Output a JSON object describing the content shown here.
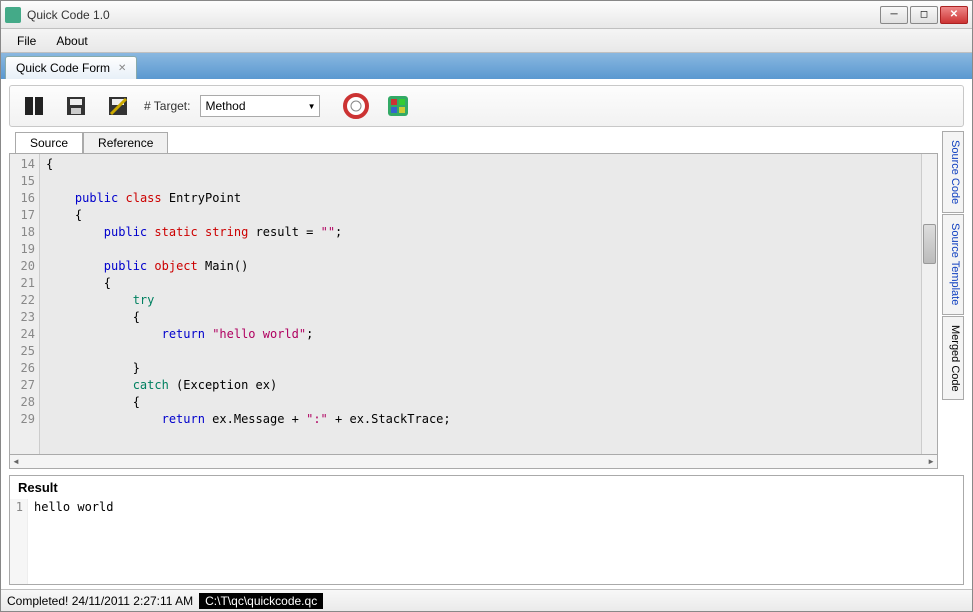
{
  "window": {
    "title": "Quick Code 1.0"
  },
  "menu": {
    "file": "File",
    "about": "About"
  },
  "docTab": {
    "label": "Quick Code Form"
  },
  "toolbar": {
    "targetLabel": "# Target:",
    "targetValue": "Method"
  },
  "codeTabs": {
    "source": "Source",
    "reference": "Reference"
  },
  "sideTabs": {
    "sourceCode": "Source Code",
    "sourceTemplate": "Source Template",
    "mergedCode": "Merged Code"
  },
  "code": {
    "startLine": 14,
    "lines": [
      [
        {
          "t": "{",
          "c": ""
        }
      ],
      [],
      [
        {
          "t": "    ",
          "c": ""
        },
        {
          "t": "public",
          "c": "kw-blue"
        },
        {
          "t": " ",
          "c": ""
        },
        {
          "t": "class",
          "c": "kw-red"
        },
        {
          "t": " EntryPoint",
          "c": ""
        }
      ],
      [
        {
          "t": "    {",
          "c": ""
        }
      ],
      [
        {
          "t": "        ",
          "c": ""
        },
        {
          "t": "public",
          "c": "kw-blue"
        },
        {
          "t": " ",
          "c": ""
        },
        {
          "t": "static",
          "c": "kw-red"
        },
        {
          "t": " ",
          "c": ""
        },
        {
          "t": "string",
          "c": "kw-red"
        },
        {
          "t": " result = ",
          "c": ""
        },
        {
          "t": "\"\"",
          "c": "kw-str"
        },
        {
          "t": ";",
          "c": ""
        }
      ],
      [],
      [
        {
          "t": "        ",
          "c": ""
        },
        {
          "t": "public",
          "c": "kw-blue"
        },
        {
          "t": " ",
          "c": ""
        },
        {
          "t": "object",
          "c": "kw-red"
        },
        {
          "t": " Main()",
          "c": ""
        }
      ],
      [
        {
          "t": "        {",
          "c": ""
        }
      ],
      [
        {
          "t": "            ",
          "c": ""
        },
        {
          "t": "try",
          "c": "kw-green"
        }
      ],
      [
        {
          "t": "            {",
          "c": ""
        }
      ],
      [
        {
          "t": "                ",
          "c": ""
        },
        {
          "t": "return",
          "c": "kw-blue"
        },
        {
          "t": " ",
          "c": ""
        },
        {
          "t": "\"hello world\"",
          "c": "kw-str"
        },
        {
          "t": ";",
          "c": ""
        }
      ],
      [],
      [
        {
          "t": "            }",
          "c": ""
        }
      ],
      [
        {
          "t": "            ",
          "c": ""
        },
        {
          "t": "catch",
          "c": "kw-green"
        },
        {
          "t": " (Exception ex)",
          "c": ""
        }
      ],
      [
        {
          "t": "            {",
          "c": ""
        }
      ],
      [
        {
          "t": "                ",
          "c": ""
        },
        {
          "t": "return",
          "c": "kw-blue"
        },
        {
          "t": " ex.Message + ",
          "c": ""
        },
        {
          "t": "\":\"",
          "c": "kw-str"
        },
        {
          "t": " + ex.StackTrace;",
          "c": ""
        }
      ]
    ]
  },
  "result": {
    "title": "Result",
    "lineNo": "1",
    "text": "hello world"
  },
  "status": {
    "msg": "Completed! 24/11/2011 2:27:11 AM",
    "path": "C:\\T\\qc\\quickcode.qc"
  }
}
